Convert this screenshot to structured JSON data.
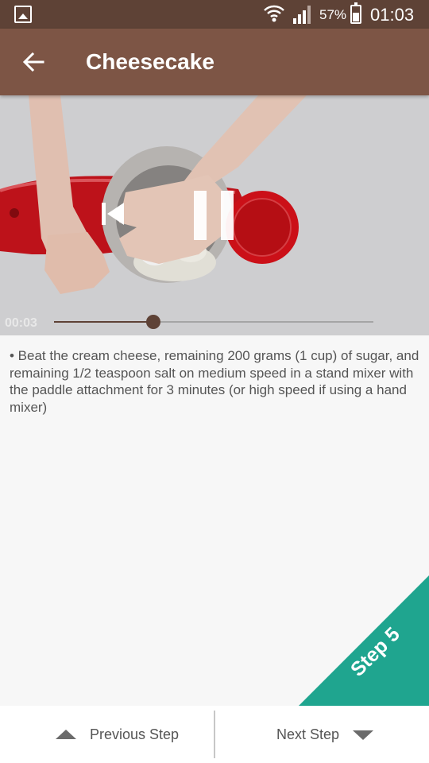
{
  "status_bar": {
    "battery_percent": "57%",
    "battery_level": 0.57,
    "time": "01:03",
    "icons": [
      "gallery-icon",
      "wifi-icon",
      "signal-icon",
      "battery-icon"
    ]
  },
  "app_bar": {
    "title": "Cheesecake",
    "back_icon": "arrow-left-icon"
  },
  "video": {
    "elapsed": "00:03",
    "progress": 0.31,
    "controls": [
      "previous-icon",
      "pause-icon"
    ]
  },
  "step": {
    "description": "• Beat the cream cheese, remaining 200 grams (1 cup) of sugar, and remaining 1/2 teaspoon salt on medium speed in a stand mixer with the paddle attachment for 3 minutes (or high speed if using a hand mixer)",
    "badge": "Step 5"
  },
  "navigation": {
    "previous_label": "Previous Step",
    "next_label": "Next Step"
  },
  "colors": {
    "status_bar": "#5e4236",
    "app_bar": "#7d5545",
    "step_badge": "#1fa58f",
    "background": "#f7f7f7"
  }
}
